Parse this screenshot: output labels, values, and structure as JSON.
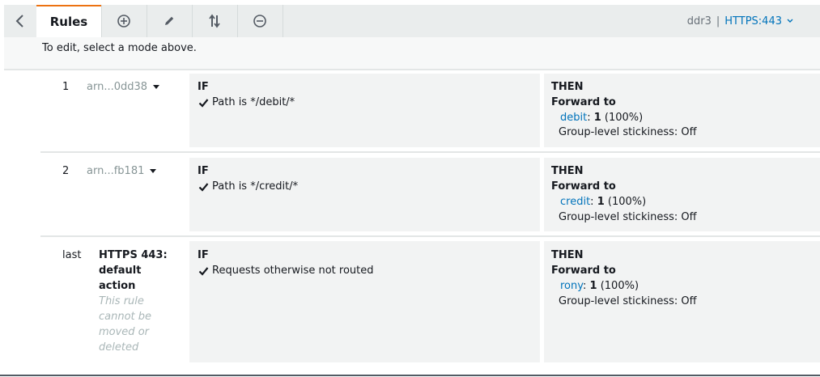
{
  "toolbar": {
    "back_icon": "chevron-left-icon",
    "tab_label": "Rules",
    "add_icon": "plus-circle-icon",
    "edit_icon": "pencil-icon",
    "reorder_icon": "reorder-arrows-icon",
    "delete_icon": "minus-circle-icon",
    "load_balancer": "ddr3",
    "separator": "|",
    "listener": "HTTPS:443"
  },
  "subbar": {
    "text": "To edit, select a mode above."
  },
  "rules": [
    {
      "number": "1",
      "arn": "arn...0dd38",
      "if_label": "IF",
      "condition": "Path is */debit/*",
      "then_label": "THEN",
      "action": "Forward to",
      "target": "debit",
      "weight": "1",
      "percent": "(100%)",
      "stickiness": "Group-level stickiness: Off"
    },
    {
      "number": "2",
      "arn": "arn...fb181",
      "if_label": "IF",
      "condition": "Path is */credit/*",
      "then_label": "THEN",
      "action": "Forward to",
      "target": "credit",
      "weight": "1",
      "percent": "(100%)",
      "stickiness": "Group-level stickiness: Off"
    },
    {
      "number": "last",
      "default_label": "HTTPS 443: default action",
      "default_note": "This rule cannot be moved or deleted",
      "if_label": "IF",
      "condition": "Requests otherwise not routed",
      "then_label": "THEN",
      "action": "Forward to",
      "target": "rony",
      "weight": "1",
      "percent": "(100%)",
      "stickiness": "Group-level stickiness: Off"
    }
  ],
  "colors": {
    "accent": "#ec7211",
    "link": "#0073bb",
    "cell_bg": "#f2f3f3",
    "toolbar_bg": "#eaeded"
  }
}
